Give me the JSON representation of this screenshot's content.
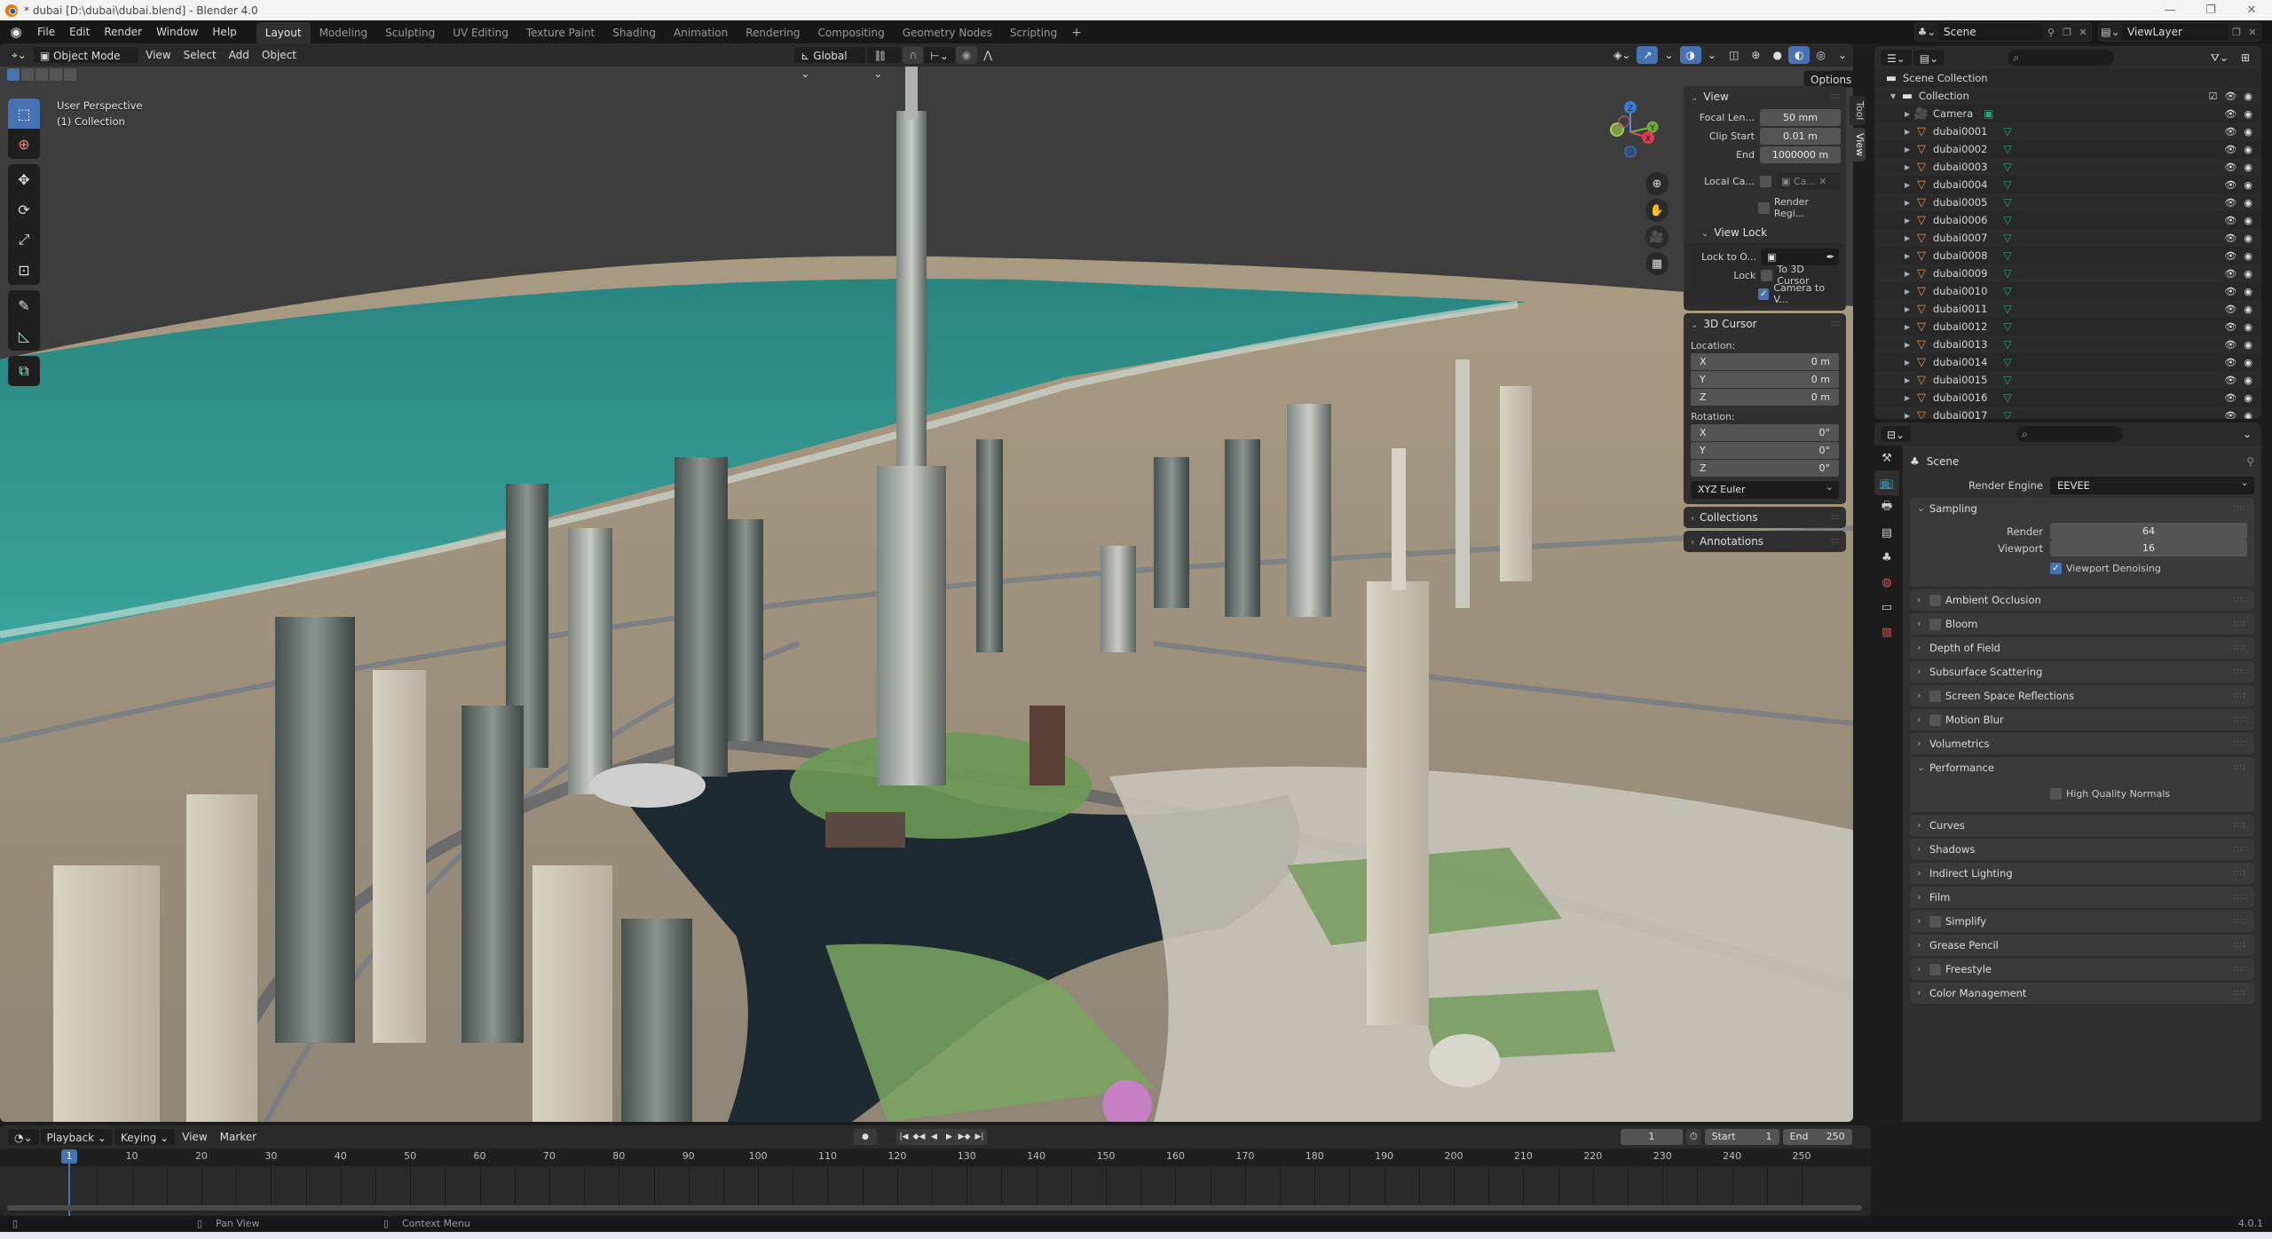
{
  "window": {
    "title": "* dubai [D:\\dubai\\dubai.blend] - Blender 4.0",
    "controls": [
      "minimize",
      "maximize",
      "close"
    ]
  },
  "topbar": {
    "menus": [
      "File",
      "Edit",
      "Render",
      "Window",
      "Help"
    ],
    "workspaces": [
      "Layout",
      "Modeling",
      "Sculpting",
      "UV Editing",
      "Texture Paint",
      "Shading",
      "Animation",
      "Rendering",
      "Compositing",
      "Geometry Nodes",
      "Scripting"
    ],
    "active_workspace": "Layout",
    "add_workspace": "+",
    "scene": "Scene",
    "view_layer": "ViewLayer"
  },
  "viewport": {
    "mode": "Object Mode",
    "menus": [
      "View",
      "Select",
      "Add",
      "Object"
    ],
    "orientation": "Global",
    "options_label": "Options",
    "info_line1": "User Perspective",
    "info_line2": "(1) Collection",
    "tools": [
      "select-box",
      "cursor",
      "move",
      "rotate",
      "scale",
      "transform",
      "annotate",
      "measure",
      "add-cube"
    ],
    "gizmo_axes": [
      "Z",
      "Y",
      "X"
    ],
    "colors": {
      "sea": "#2f8f8c",
      "sand": "#b8a489",
      "lake": "#1e2a31",
      "grass": "#6b9a55",
      "sky": "#3d3d3d"
    }
  },
  "npanel": {
    "tabs": [
      "Tool",
      "View"
    ],
    "active_tab": "View",
    "view": {
      "title": "View",
      "focal_length_label": "Focal Len...",
      "focal_length": "50 mm",
      "clip_start_label": "Clip Start",
      "clip_start": "0.01 m",
      "clip_end_label": "End",
      "clip_end": "1000000 m",
      "local_camera_label": "Local Ca...",
      "local_camera_value": "Ca...",
      "render_region_label": "Render Regi..."
    },
    "view_lock": {
      "title": "View Lock",
      "lock_to_object_label": "Lock to O...",
      "lock_label": "Lock",
      "to_3d_cursor": "To 3D Cursor",
      "to_3d_cursor_checked": false,
      "camera_to_view": "Camera to V...",
      "camera_to_view_checked": true
    },
    "cursor": {
      "title": "3D Cursor",
      "location_label": "Location:",
      "location": [
        {
          "axis": "X",
          "value": "0 m"
        },
        {
          "axis": "Y",
          "value": "0 m"
        },
        {
          "axis": "Z",
          "value": "0 m"
        }
      ],
      "rotation_label": "Rotation:",
      "rotation": [
        {
          "axis": "X",
          "value": "0°"
        },
        {
          "axis": "Y",
          "value": "0°"
        },
        {
          "axis": "Z",
          "value": "0°"
        }
      ],
      "rotation_mode": "XYZ Euler"
    },
    "collections_title": "Collections",
    "annotations_title": "Annotations"
  },
  "outliner": {
    "search_placeholder": "",
    "scene_collection": "Scene Collection",
    "collection": "Collection",
    "items": [
      {
        "name": "Camera",
        "type": "camera"
      },
      {
        "name": "dubai0001",
        "type": "mesh"
      },
      {
        "name": "dubai0002",
        "type": "mesh"
      },
      {
        "name": "dubai0003",
        "type": "mesh"
      },
      {
        "name": "dubai0004",
        "type": "mesh"
      },
      {
        "name": "dubai0005",
        "type": "mesh"
      },
      {
        "name": "dubai0006",
        "type": "mesh"
      },
      {
        "name": "dubai0007",
        "type": "mesh"
      },
      {
        "name": "dubai0008",
        "type": "mesh"
      },
      {
        "name": "dubai0009",
        "type": "mesh"
      },
      {
        "name": "dubai0010",
        "type": "mesh"
      },
      {
        "name": "dubai0011",
        "type": "mesh"
      },
      {
        "name": "dubai0012",
        "type": "mesh"
      },
      {
        "name": "dubai0013",
        "type": "mesh"
      },
      {
        "name": "dubai0014",
        "type": "mesh"
      },
      {
        "name": "dubai0015",
        "type": "mesh"
      },
      {
        "name": "dubai0016",
        "type": "mesh"
      },
      {
        "name": "dubai0017",
        "type": "mesh"
      }
    ]
  },
  "properties": {
    "context": "Scene",
    "render_engine_label": "Render Engine",
    "render_engine": "EEVEE",
    "sampling": {
      "title": "Sampling",
      "render_label": "Render",
      "render": "64",
      "viewport_label": "Viewport",
      "viewport": "16",
      "denoise_label": "Viewport Denoising",
      "denoise_checked": true
    },
    "panels_a": [
      {
        "title": "Ambient Occlusion",
        "checkbox": true
      },
      {
        "title": "Bloom",
        "checkbox": true
      },
      {
        "title": "Depth of Field",
        "checkbox": false
      },
      {
        "title": "Subsurface Scattering",
        "checkbox": false
      },
      {
        "title": "Screen Space Reflections",
        "checkbox": true
      },
      {
        "title": "Motion Blur",
        "checkbox": true
      },
      {
        "title": "Volumetrics",
        "checkbox": false
      }
    ],
    "performance": {
      "title": "Performance",
      "hq_normals_label": "High Quality Normals",
      "hq_normals_checked": false
    },
    "panels_b": [
      {
        "title": "Curves",
        "checkbox": false
      },
      {
        "title": "Shadows",
        "checkbox": false
      },
      {
        "title": "Indirect Lighting",
        "checkbox": false
      },
      {
        "title": "Film",
        "checkbox": false
      },
      {
        "title": "Simplify",
        "checkbox": true
      },
      {
        "title": "Grease Pencil",
        "checkbox": false
      },
      {
        "title": "Freestyle",
        "checkbox": true
      },
      {
        "title": "Color Management",
        "checkbox": false
      }
    ]
  },
  "timeline": {
    "menus": [
      "Playback",
      "Keying",
      "View",
      "Marker"
    ],
    "current_frame": "1",
    "start_label": "Start",
    "start": "1",
    "end_label": "End",
    "end": "250",
    "ticks": [
      "10",
      "20",
      "30",
      "40",
      "50",
      "60",
      "70",
      "80",
      "90",
      "100",
      "110",
      "120",
      "130",
      "140",
      "150",
      "160",
      "170",
      "180",
      "190",
      "200",
      "210",
      "220",
      "230",
      "240",
      "250"
    ],
    "frame_range": [
      1,
      250
    ]
  },
  "statusbar": {
    "pan_view": "Pan View",
    "context_menu": "Context Menu",
    "version": "4.0.1"
  }
}
